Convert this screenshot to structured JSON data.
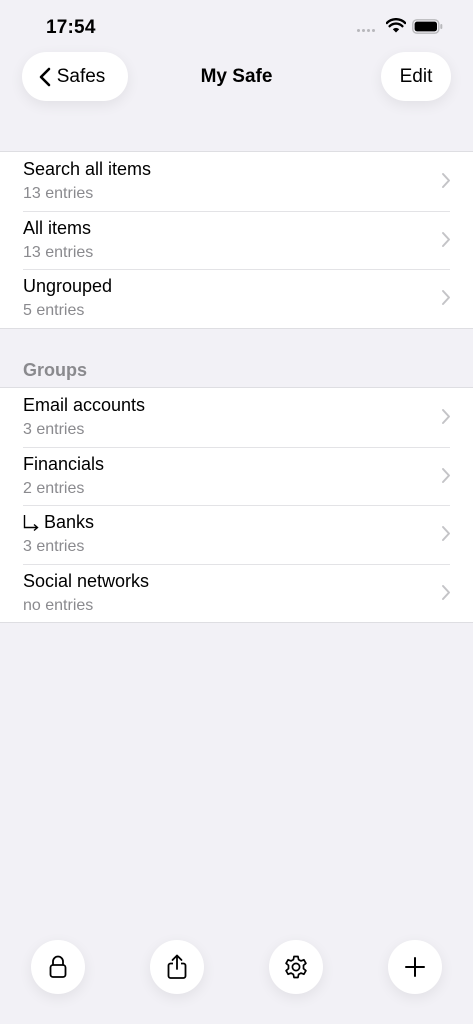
{
  "status": {
    "time": "17:54"
  },
  "nav": {
    "back_label": "Safes",
    "title": "My Safe",
    "edit_label": "Edit"
  },
  "top_items": [
    {
      "title": "Search all items",
      "subtitle": "13 entries"
    },
    {
      "title": "All items",
      "subtitle": "13 entries"
    },
    {
      "title": "Ungrouped",
      "subtitle": "5 entries"
    }
  ],
  "groups": {
    "header": "Groups",
    "items": [
      {
        "title": "Email accounts",
        "subtitle": "3 entries",
        "subgroup": false
      },
      {
        "title": "Financials",
        "subtitle": "2 entries",
        "subgroup": false
      },
      {
        "title": "Banks",
        "subtitle": "3 entries",
        "subgroup": true
      },
      {
        "title": "Social networks",
        "subtitle": "no entries",
        "subgroup": false
      }
    ]
  },
  "toolbar": {
    "icons": [
      "lock-icon",
      "share-icon",
      "gear-icon",
      "plus-icon"
    ]
  },
  "colors": {
    "background": "#f2f1f6",
    "secondary_text": "#8a8a8e",
    "chevron": "#c4c4c7"
  }
}
